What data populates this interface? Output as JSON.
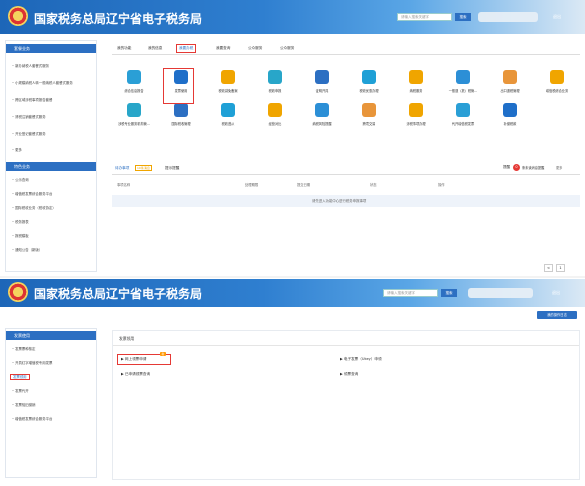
{
  "header": {
    "title": "国家税务总局辽宁省电子税务局",
    "search_placeholder": "请输入搜索关键字",
    "search_button": "搜索",
    "exit_label": "退出"
  },
  "top": {
    "sidebar": {
      "section1_title": "套餐业务",
      "section1_items": [
        "新办纳税人套餐式服务",
        "小规模纳税人转一般纳税人套餐式服务",
        "跨区域涉税事项报告套餐",
        "清税注销套餐式服务",
        "开业登记套餐式服务",
        "更多"
      ],
      "section2_title": "特色业务",
      "section2_items": [
        "公示查询",
        "增值税发票综合服务平台",
        "国际税收业务（税收协定）",
        "税务报表",
        "报税模板",
        "通知公告（新版）"
      ]
    },
    "tabs": [
      "我的功能",
      "我的信息",
      "我要办税",
      "我要查询",
      "公众服务",
      "公众服务"
    ],
    "icons_row1": [
      "综合信息报告",
      "发票使用",
      "税收减免备案",
      "税收申报",
      "证明开具",
      "税收优惠办理",
      "纳税服务",
      "一般退（抵）税管...",
      "出口退税管理",
      "增值税综合业务"
    ],
    "icons_row2": [
      "涉税专业服务机构管...",
      "国际税收管理",
      "税收遵从",
      "经营对比",
      "纳税风险提醒",
      "跨境交易",
      "涉税事项办理",
      "代开增值税发票",
      "补缴税款"
    ],
    "sub_tabs": [
      "待办事项",
      "10条消息",
      "提示提醒"
    ],
    "notice_count": "0",
    "notice_label": "条未读消息提醒",
    "more_label": "更多",
    "table_headers": [
      "事项名称",
      "处理期限",
      "提交日期",
      "状态",
      "操作"
    ],
    "empty_text": "请先进入功能中心进行税务申报事项",
    "pagination": [
      "<",
      "1"
    ]
  },
  "bottom": {
    "top_right_button": "我的操作日志",
    "sidebar_title": "发票使用",
    "sidebar_items": [
      "发票票种核定",
      "开具红字增值税专用发票",
      "发票领用",
      "发票代开",
      "发票验旧缴销",
      "增值税发票综合服务平台"
    ],
    "panel_title": "发票领用",
    "links": [
      "网上领票申请",
      "电子发票（Ukey）申领",
      "已申请领票查询",
      "领票查询"
    ],
    "badge": "新"
  },
  "colors": {
    "header_blue": "#1d66b8",
    "accent_red": "#e53935",
    "sidebar_blue": "#2c6fc2"
  }
}
